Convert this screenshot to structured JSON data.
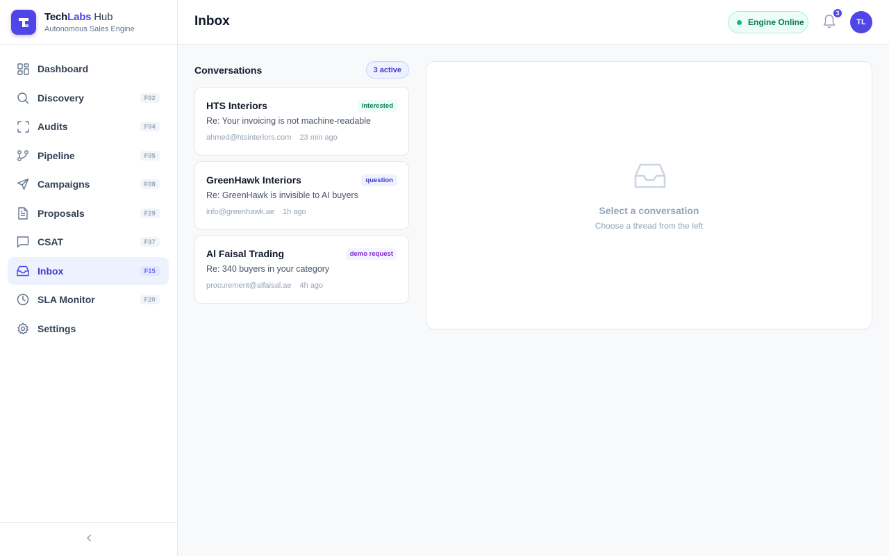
{
  "brand": {
    "name_part1": "Tech",
    "name_part2": "Labs",
    "name_part3": " Hub",
    "subtitle": "Autonomous Sales Engine",
    "accent_color": "#4f46e5"
  },
  "sidebar": {
    "items": [
      {
        "label": "Dashboard",
        "shortcut": "",
        "icon": "grid-icon",
        "active": false
      },
      {
        "label": "Discovery",
        "shortcut": "F02",
        "icon": "search-icon",
        "active": false
      },
      {
        "label": "Audits",
        "shortcut": "F04",
        "icon": "scan-icon",
        "active": false
      },
      {
        "label": "Pipeline",
        "shortcut": "F05",
        "icon": "branch-icon",
        "active": false
      },
      {
        "label": "Campaigns",
        "shortcut": "F08",
        "icon": "send-icon",
        "active": false
      },
      {
        "label": "Proposals",
        "shortcut": "F29",
        "icon": "document-icon",
        "active": false
      },
      {
        "label": "CSAT",
        "shortcut": "F37",
        "icon": "message-square-icon",
        "active": false
      },
      {
        "label": "Inbox",
        "shortcut": "F15",
        "icon": "inbox-icon",
        "active": true
      },
      {
        "label": "SLA Monitor",
        "shortcut": "F20",
        "icon": "clock-icon",
        "active": false
      },
      {
        "label": "Settings",
        "shortcut": "",
        "icon": "gear-icon",
        "active": false
      }
    ],
    "collapse_icon": "chevron-left-icon"
  },
  "header": {
    "title": "Inbox",
    "engine_status": "Engine Online",
    "notification_count": "3",
    "avatar_initials": "TL"
  },
  "conversations": {
    "title": "Conversations",
    "count_label": "3 active",
    "items": [
      {
        "company": "HTS Interiors",
        "tag": "interested",
        "tag_color": "#047857",
        "subject": "Re: Your invoicing is not machine-readable",
        "email": "ahmed@htsinteriors.com",
        "time": "23 min ago"
      },
      {
        "company": "GreenHawk Interiors",
        "tag": "question",
        "tag_color": "#4338ca",
        "subject": "Re: GreenHawk is invisible to AI buyers",
        "email": "info@greenhawk.ae",
        "time": "1h ago"
      },
      {
        "company": "Al Faisal Trading",
        "tag": "demo request",
        "tag_color": "#7e22ce",
        "subject": "Re: 340 buyers in your category",
        "email": "procurement@alfaisal.ae",
        "time": "4h ago"
      }
    ]
  },
  "detail": {
    "empty_icon": "inbox-icon",
    "empty_title": "Select a conversation",
    "empty_subtitle": "Choose a thread from the left"
  }
}
